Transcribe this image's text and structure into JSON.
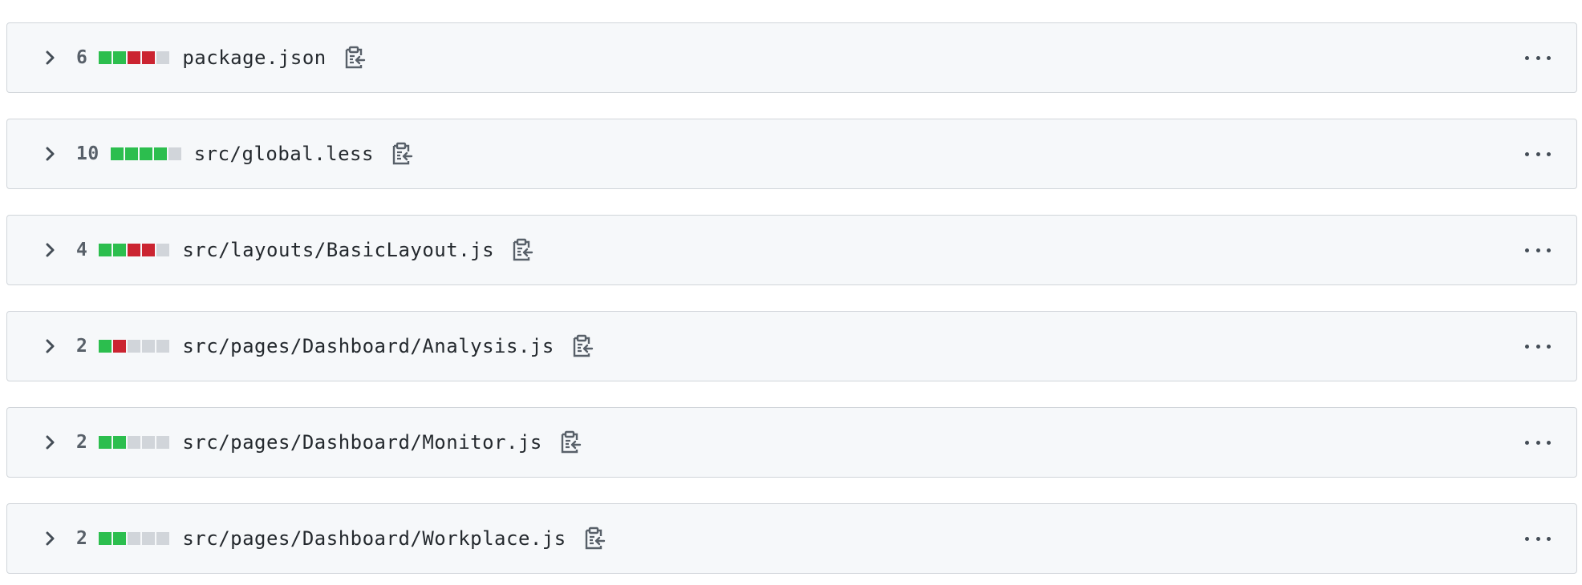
{
  "colors": {
    "added": "#2cbe4e",
    "deleted": "#cb2431",
    "neutral": "#d1d5da",
    "icon": "#586069"
  },
  "icons": {
    "expand": "chevron-right-icon",
    "copy": "clipboard-copy-icon",
    "more": "kebab-horizontal-icon"
  },
  "files": [
    {
      "changes": "6",
      "path": "package.json",
      "diffstat": [
        "added",
        "added",
        "deleted",
        "deleted",
        "neutral"
      ]
    },
    {
      "changes": "10",
      "path": "src/global.less",
      "diffstat": [
        "added",
        "added",
        "added",
        "added",
        "neutral"
      ]
    },
    {
      "changes": "4",
      "path": "src/layouts/BasicLayout.js",
      "diffstat": [
        "added",
        "added",
        "deleted",
        "deleted",
        "neutral"
      ]
    },
    {
      "changes": "2",
      "path": "src/pages/Dashboard/Analysis.js",
      "diffstat": [
        "added",
        "deleted",
        "neutral",
        "neutral",
        "neutral"
      ]
    },
    {
      "changes": "2",
      "path": "src/pages/Dashboard/Monitor.js",
      "diffstat": [
        "added",
        "added",
        "neutral",
        "neutral",
        "neutral"
      ]
    },
    {
      "changes": "2",
      "path": "src/pages/Dashboard/Workplace.js",
      "diffstat": [
        "added",
        "added",
        "neutral",
        "neutral",
        "neutral"
      ]
    }
  ]
}
